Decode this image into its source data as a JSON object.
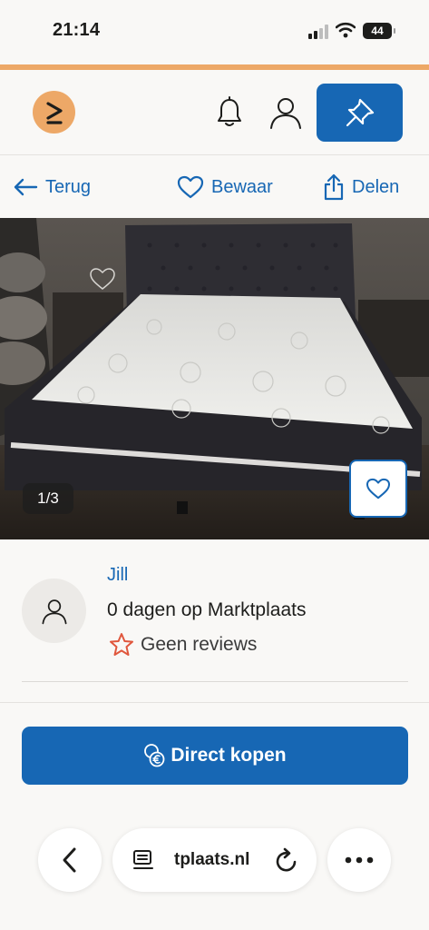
{
  "status_bar": {
    "time": "21:14",
    "battery": "44"
  },
  "icons": {
    "logo": "marktplaats-logo-icon",
    "bell": "bell-icon",
    "user": "user-icon",
    "place_ad": "pin-icon",
    "back": "arrow-left-icon",
    "save": "heart-icon",
    "share": "share-icon",
    "buy": "euro-coins-icon",
    "star": "star-icon",
    "browser_back": "chevron-left-icon",
    "reader": "reader-icon",
    "reload": "reload-icon",
    "more": "ellipsis-icon"
  },
  "colors": {
    "accent": "#1767b4",
    "brand_orange": "#eda867",
    "star": "#e0573d"
  },
  "action_bar": {
    "back_label": "Terug",
    "save_label": "Bewaar",
    "share_label": "Delen"
  },
  "listing": {
    "image_counter": "1/3"
  },
  "seller": {
    "name": "Jill",
    "since": "0 dagen op Marktplaats",
    "reviews": "Geen reviews"
  },
  "buy": {
    "label": "Direct kopen"
  },
  "browser": {
    "url": "tplaats.nl"
  }
}
